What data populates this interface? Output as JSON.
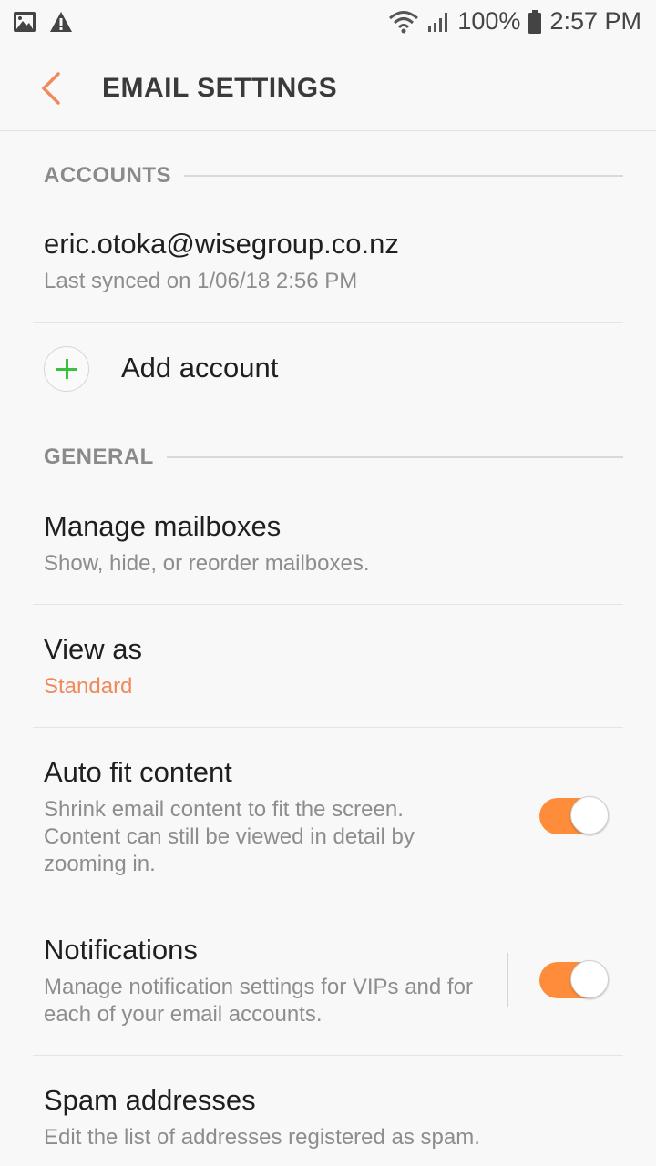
{
  "status_bar": {
    "battery": "100%",
    "time": "2:57 PM",
    "icons": [
      "image-icon",
      "warning-icon",
      "wifi-icon",
      "signal-icon",
      "battery-icon"
    ]
  },
  "header": {
    "title": "EMAIL SETTINGS"
  },
  "accounts": {
    "section_label": "ACCOUNTS",
    "email": "eric.otoka@wisegroup.co.nz",
    "synced": "Last synced on 1/06/18  2:56 PM",
    "add_label": "Add account"
  },
  "general": {
    "section_label": "GENERAL",
    "manage_title": "Manage mailboxes",
    "manage_sub": "Show, hide, or reorder mailboxes.",
    "viewas_title": "View as",
    "viewas_value": "Standard",
    "autofit_title": "Auto fit content",
    "autofit_sub": "Shrink email content to fit the screen. Content can still be viewed in detail by zooming in.",
    "autofit_on": true,
    "notif_title": "Notifications",
    "notif_sub": "Manage notification settings for VIPs and for each of your email accounts.",
    "notif_on": true,
    "spam_title": "Spam addresses",
    "spam_sub": "Edit the list of addresses registered as spam."
  },
  "colors": {
    "accent": "#f0895b",
    "toggle_on": "#ff8c3a",
    "add_plus": "#3cbf3c"
  }
}
